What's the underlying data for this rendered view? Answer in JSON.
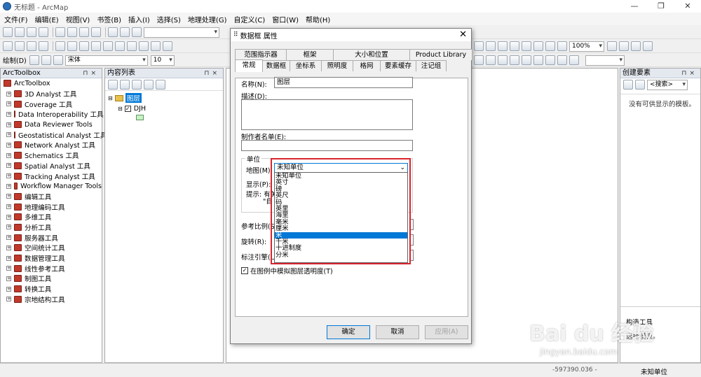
{
  "window": {
    "title": "无标题 - ArcMap"
  },
  "menu": [
    "文件(F)",
    "编辑(E)",
    "视图(V)",
    "书签(B)",
    "插入(I)",
    "选择(S)",
    "地理处理(G)",
    "自定义(C)",
    "窗口(W)",
    "帮助(H)"
  ],
  "toolbar": {
    "draw_label": "绘制(D)",
    "font_name": "宋体",
    "font_size": "10",
    "scale": "100%"
  },
  "arctoolbox": {
    "title": "ArcToolbox",
    "root": "ArcToolbox",
    "items": [
      "3D Analyst 工具",
      "Coverage 工具",
      "Data Interoperability 工具",
      "Data Reviewer Tools",
      "Geostatistical Analyst 工具",
      "Network Analyst 工具",
      "Schematics 工具",
      "Spatial Analyst 工具",
      "Tracking Analyst 工具",
      "Workflow Manager Tools",
      "编辑工具",
      "地理编码工具",
      "多维工具",
      "分析工具",
      "服务器工具",
      "空间统计工具",
      "数据管理工具",
      "线性参考工具",
      "制图工具",
      "转换工具",
      "宗地结构工具"
    ]
  },
  "toc": {
    "title": "内容列表",
    "frame": "图层",
    "layer": "DJH"
  },
  "create_features": {
    "title": "创建要素",
    "search_placeholder": "<搜索>",
    "empty": "没有可供显示的模板。",
    "build_tools": "构造工具",
    "hint": "选择模板。"
  },
  "dialog": {
    "title": "数据框 属性",
    "tabs_row1": [
      "范围指示器",
      "框架",
      "大小和位置",
      "Product Library"
    ],
    "tabs_row2": [
      "常规",
      "数据框",
      "坐标系",
      "照明度",
      "格网",
      "要素缓存",
      "注记组"
    ],
    "name_label": "名称(N):",
    "name_value": "图层",
    "desc_label": "描述(D):",
    "credits_label": "制作者名单(E):",
    "units_group": "单位",
    "map_units_label": "地图(M):",
    "map_units_value": "未知单位",
    "display_label": "显示(P):",
    "hint_label": "提示: 有关",
    "hint_line2": "\"自",
    "ref_scale_label": "参考比例(S)",
    "rotation_label": "旋转(R):",
    "label_engine_label": "标注引擎(L)",
    "simulate_transparency": "在图例中模拟图层透明度(T)",
    "units_options": [
      "未知单位",
      "英寸",
      "磅",
      "英尺",
      "码",
      "英里",
      "海里",
      "毫米",
      "厘米",
      "米",
      "千米",
      "十进制度",
      "分米"
    ],
    "selected_unit": "米",
    "ok": "确定",
    "cancel": "取消",
    "apply": "应用(A)"
  },
  "status": {
    "coords": "-597390.036 -",
    "units": "未知单位"
  },
  "watermark": {
    "brand": "Bai du 经验",
    "url": "jingyan.baidu.com"
  },
  "colors": {
    "selection": "#0078d7",
    "highlight_box": "#d9232d",
    "toolbox_icon": "#c0392b"
  }
}
